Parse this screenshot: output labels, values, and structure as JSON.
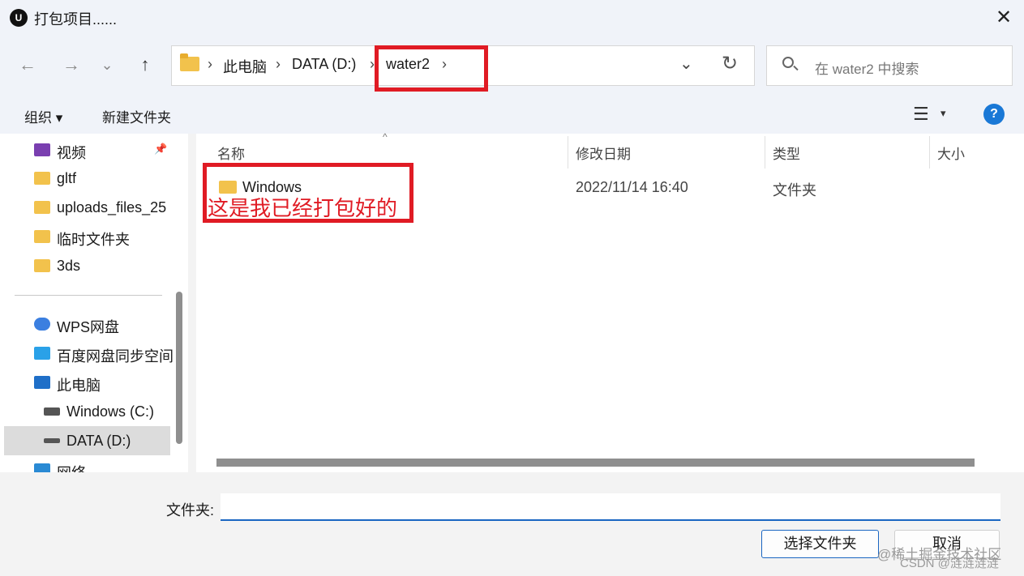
{
  "window": {
    "title": "打包项目......",
    "logo": "U",
    "close": "✕"
  },
  "nav": {
    "back": "←",
    "forward": "→",
    "recent": "⌄",
    "up": "↑"
  },
  "breadcrumb": [
    {
      "label": "此电脑",
      "sep": "›"
    },
    {
      "label": "DATA (D:)",
      "sep": "›"
    },
    {
      "label": "water2",
      "sep": "›"
    }
  ],
  "breadcrumb_first_sep": "›",
  "address_dropdown": "⌄",
  "refresh": "↻",
  "search": {
    "placeholder": "在 water2 中搜索"
  },
  "toolbar": {
    "organize": "组织 ▾",
    "new_folder": "新建文件夹",
    "view": "☰",
    "view_caret": "▾",
    "help": "?"
  },
  "sidebar": {
    "items": [
      {
        "label": "视频"
      },
      {
        "label": "gltf"
      },
      {
        "label": "uploads_files_25"
      },
      {
        "label": "临时文件夹"
      },
      {
        "label": "3ds"
      },
      {
        "label": "WPS网盘"
      },
      {
        "label": "百度网盘同步空间"
      },
      {
        "label": "此电脑"
      },
      {
        "label": "Windows (C:)"
      },
      {
        "label": "DATA (D:)"
      },
      {
        "label": "网络"
      }
    ],
    "pin": "📌"
  },
  "columns": {
    "name": "名称",
    "date": "修改日期",
    "type": "类型",
    "size": "大小",
    "sort": "^"
  },
  "rows": [
    {
      "name": "Windows",
      "date": "2022/11/14 16:40",
      "type": "文件夹"
    }
  ],
  "annotation": {
    "text": "这是我已经打包好的",
    "color": "#e01b24"
  },
  "footer": {
    "folder_label": "文件夹:",
    "folder_value": "",
    "select_button": "选择文件夹",
    "cancel_button": "取消"
  },
  "watermark": {
    "line1": "@稀土掘金技术社区",
    "line2": "CSDN @涟涟涟涟"
  }
}
